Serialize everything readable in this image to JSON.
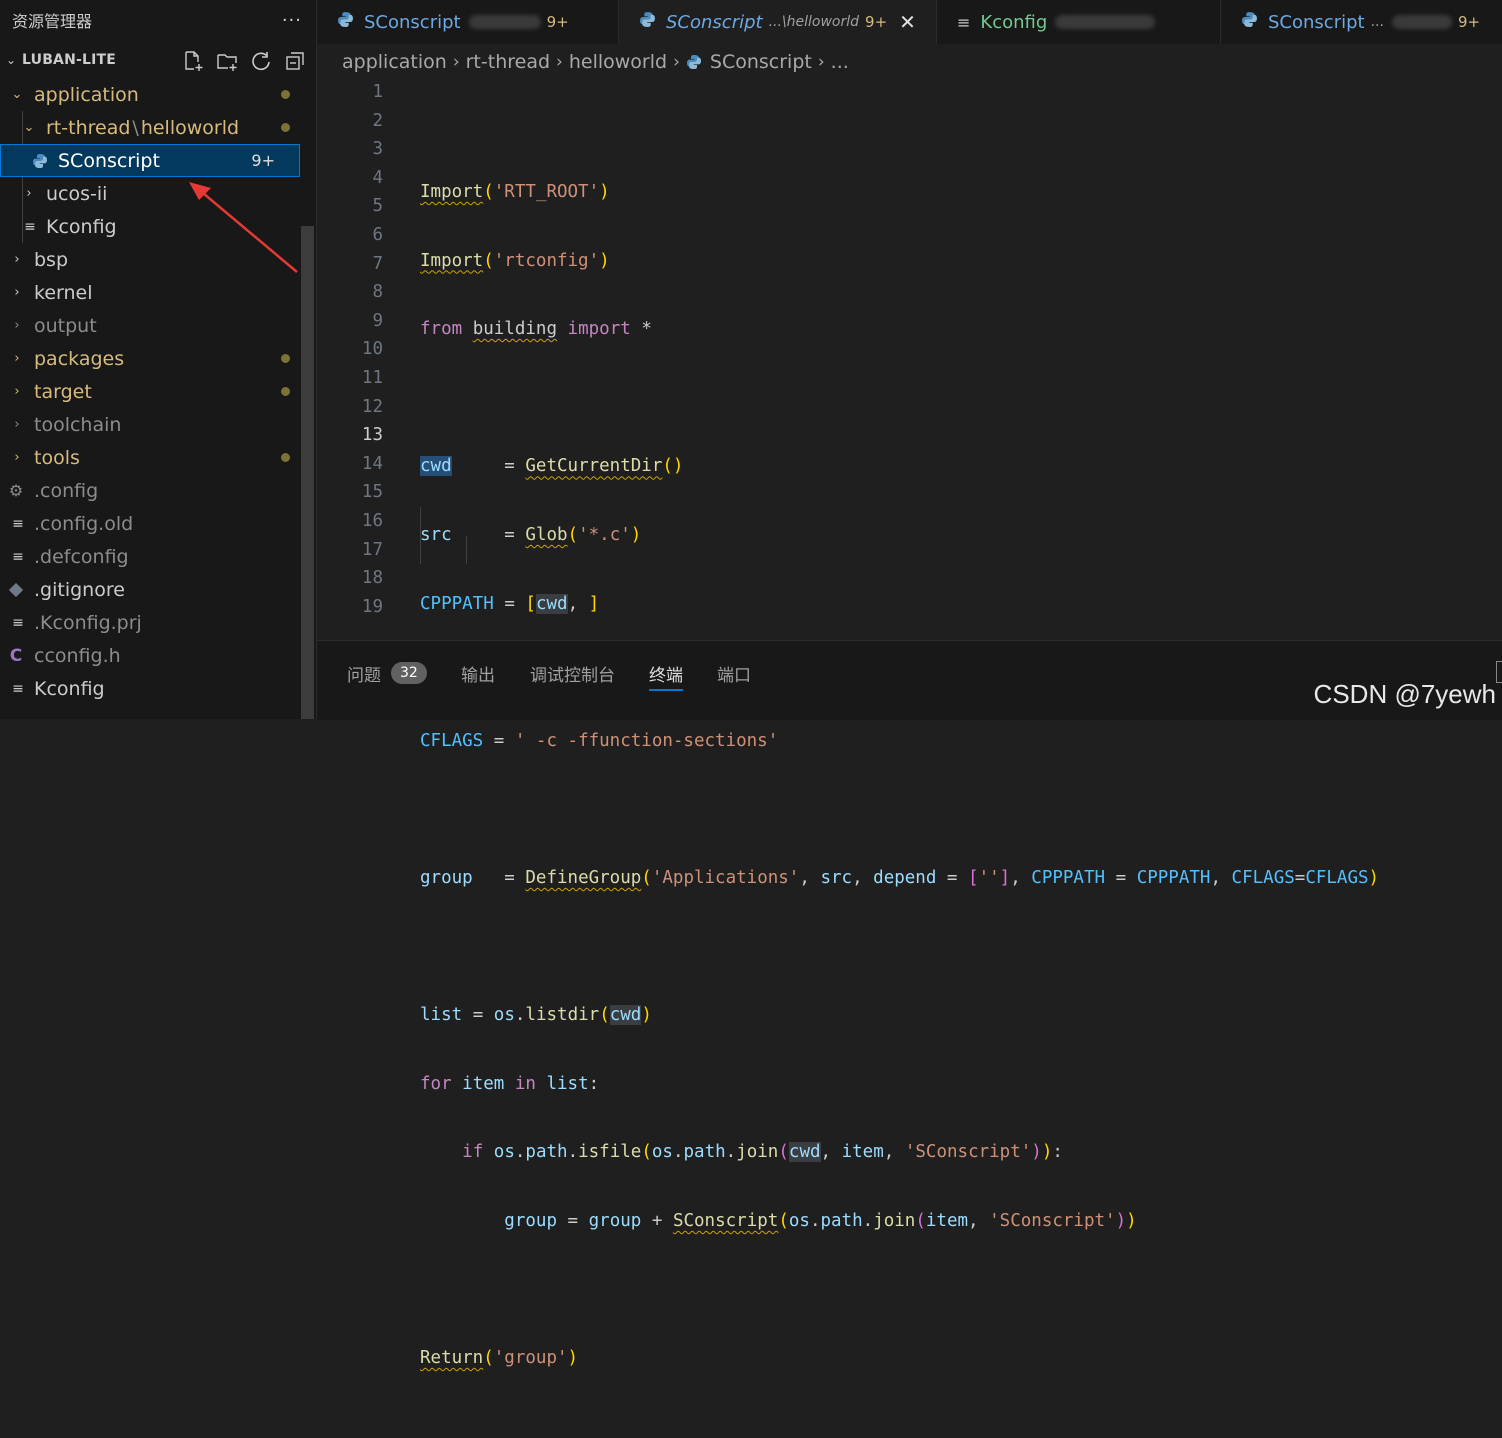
{
  "colors": {
    "accent": "#0078d4",
    "modified": "#d7ba7d",
    "keyword": "#c586c0",
    "function": "#dcdcaa",
    "string": "#ce9178",
    "variable": "#9cdcfe"
  },
  "sidebar": {
    "title": "资源管理器",
    "more": "···",
    "section_title": "LUBAN-LITE",
    "actions": [
      "new-file-icon",
      "new-folder-icon",
      "refresh-icon",
      "collapse-all-icon"
    ],
    "items": [
      {
        "label": "application",
        "chevron": "⌄",
        "status": "modified"
      },
      {
        "label": "rt-thread",
        "label_suffix": "helloworld",
        "chevron": "⌄",
        "status": "modified"
      },
      {
        "label": "SConscript",
        "badge": "9+",
        "icon": "python-icon",
        "selected": true
      },
      {
        "label": "ucos-ii",
        "chevron": "›"
      },
      {
        "label": "Kconfig",
        "icon": "lines-icon"
      },
      {
        "label": "bsp",
        "chevron": "›"
      },
      {
        "label": "kernel",
        "chevron": "›"
      },
      {
        "label": "output",
        "chevron": "›",
        "status": "ignored"
      },
      {
        "label": "packages",
        "chevron": "›",
        "status": "modified"
      },
      {
        "label": "target",
        "chevron": "›",
        "status": "modified"
      },
      {
        "label": "toolchain",
        "chevron": "›",
        "status": "ignored"
      },
      {
        "label": "tools",
        "chevron": "›",
        "status": "modified"
      },
      {
        "label": ".config",
        "icon": "gear-icon",
        "status": "ignored"
      },
      {
        "label": ".config.old",
        "icon": "lines-icon",
        "status": "ignored"
      },
      {
        "label": ".defconfig",
        "icon": "lines-icon",
        "status": "ignored"
      },
      {
        "label": ".gitignore",
        "icon": "git-icon"
      },
      {
        "label": ".Kconfig.prj",
        "icon": "lines-icon",
        "status": "ignored"
      },
      {
        "label": "cconfig.h",
        "icon": "c-icon",
        "status": "ignored"
      },
      {
        "label": "Kconfig",
        "icon": "lines-icon"
      }
    ]
  },
  "tabs": [
    {
      "name": "SConscript",
      "badge": "9+",
      "icon": "python-icon"
    },
    {
      "name": "SConscript",
      "path": "...\\helloworld",
      "badge": "9+",
      "icon": "python-icon",
      "active": true,
      "close": "✕"
    },
    {
      "name": "Kconfig",
      "icon": "lines-icon"
    },
    {
      "name": "SConscript",
      "path": "...",
      "badge": "9+",
      "icon": "python-icon"
    }
  ],
  "breadcrumb": [
    "application",
    "rt-thread",
    "helloworld",
    "SConscript",
    "..."
  ],
  "breadcrumb_sep": "›",
  "editor": {
    "current_line": 13,
    "line_numbers": [
      "1",
      "2",
      "3",
      "4",
      "5",
      "6",
      "7",
      "8",
      "9",
      "10",
      "11",
      "12",
      "13",
      "14",
      "15",
      "16",
      "17",
      "18",
      "19"
    ],
    "t": {
      "import": "Import",
      "lp": "(",
      "rp": ")",
      "rtt_root": "'RTT_ROOT'",
      "rtconfig": "'rtconfig'",
      "from": "from",
      "building": "building",
      "import_kw": "import",
      "star": "*",
      "cwd": "cwd",
      "src": "src",
      "cpppath": "CPPPATH",
      "eq5": "=",
      "get_current_dir": "GetCurrentDir",
      "glob": "Glob",
      "star_c": "'*.c'",
      "lb": "[",
      "rb": "]",
      "comma": ",",
      "cflags": "CFLAGS",
      "cflags_val": "' -c -ffunction-sections'",
      "group": "group",
      "define_group": "DefineGroup",
      "applications": "'Applications'",
      "depend": "depend",
      "empty_str": "''",
      "list": "list",
      "os": "os",
      "listdir": "listdir",
      "dot": ".",
      "for": "for",
      "item": "item",
      "in": "in",
      "colon": ":",
      "if": "if",
      "path": "path",
      "isfile": "isfile",
      "join": "join",
      "sconscript_str": "'SConscript'",
      "sconscript_fn": "SConscript",
      "plus": "+",
      "return": "Return",
      "group_str": "'group'"
    }
  },
  "panel": {
    "tabs": [
      {
        "label": "问题",
        "badge": "32"
      },
      {
        "label": "输出"
      },
      {
        "label": "调试控制台"
      },
      {
        "label": "终端",
        "active": true
      },
      {
        "label": "端口"
      }
    ]
  },
  "watermark": "CSDN @7yewh"
}
